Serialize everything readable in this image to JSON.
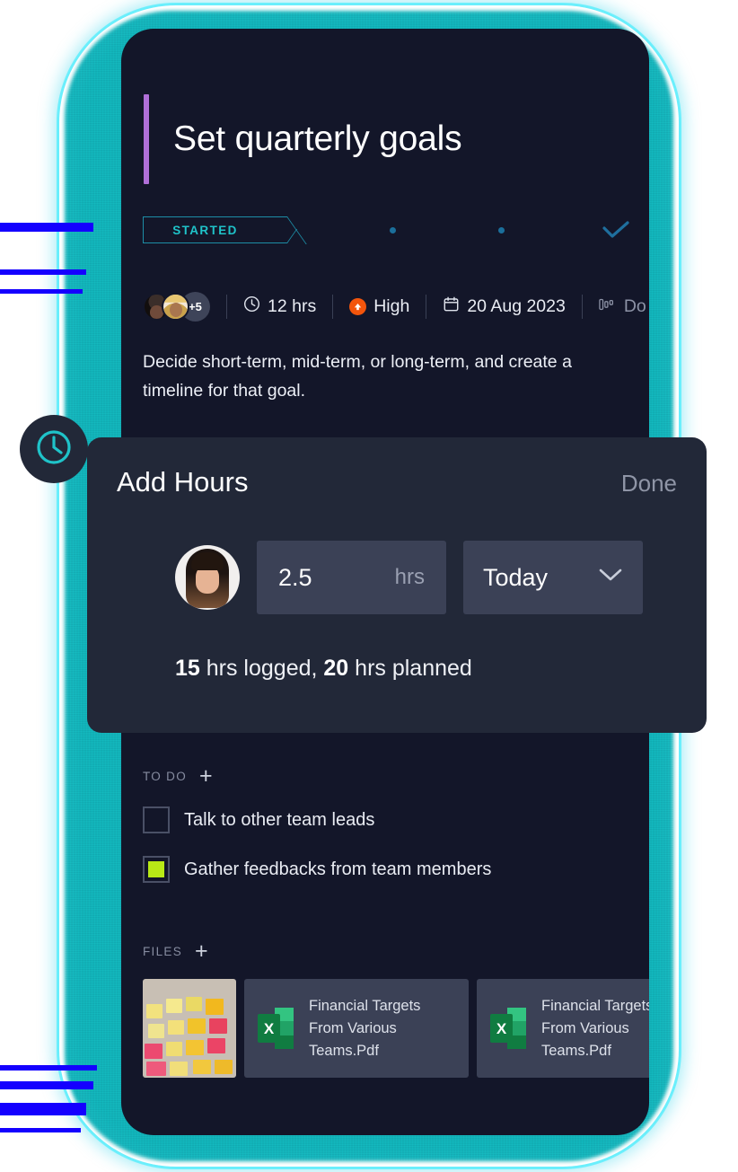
{
  "theme": {
    "glow_color": "#17b4bb",
    "card_bg": "#131629",
    "panel_bg": "#222838",
    "field_bg": "#3b4156",
    "accent_purple": "#b06fd8",
    "accent_teal": "#1fc3c9",
    "priority_orange": "#f3550c",
    "checkbox_green": "#b8e916"
  },
  "task": {
    "title": "Set quarterly goals",
    "status_chip": "STARTED",
    "progress_steps": 4,
    "current_step": 1,
    "description": "Decide short-term, mid-term, or long-term, and create a timeline for that goal.",
    "meta": {
      "assignees_overflow": "+5",
      "time_estimate": "12 hrs",
      "time_icon": "clock-icon",
      "priority": "High",
      "priority_icon": "priority-up-arrow-icon",
      "due_date": "20 Aug 2023",
      "date_icon": "calendar-icon",
      "extra_label": "Do",
      "extra_icon": "progress-bars-icon"
    }
  },
  "todo": {
    "section_label": "TO DO",
    "add_label": "+",
    "items": [
      {
        "label": "Talk to other team leads",
        "checked": false
      },
      {
        "label": "Gather feedbacks from team members",
        "checked": true
      }
    ]
  },
  "files": {
    "section_label": "FILES",
    "add_label": "+",
    "items": [
      {
        "type": "image",
        "name": ""
      },
      {
        "type": "excel",
        "name": "Financial Targets From Various Teams.Pdf"
      },
      {
        "type": "excel",
        "name": "Financial Targets From Various Teams.Pdf"
      }
    ]
  },
  "add_hours": {
    "badge_icon": "clock-icon",
    "title": "Add Hours",
    "done_label": "Done",
    "avatar": "user-avatar",
    "hours_value": "2.5",
    "hours_unit": "hrs",
    "day_value": "Today",
    "day_chevron": "chevron-down-icon",
    "summary_logged": "15",
    "summary_logged_text": " hrs logged, ",
    "summary_planned": "20",
    "summary_planned_text": " hrs planned"
  }
}
